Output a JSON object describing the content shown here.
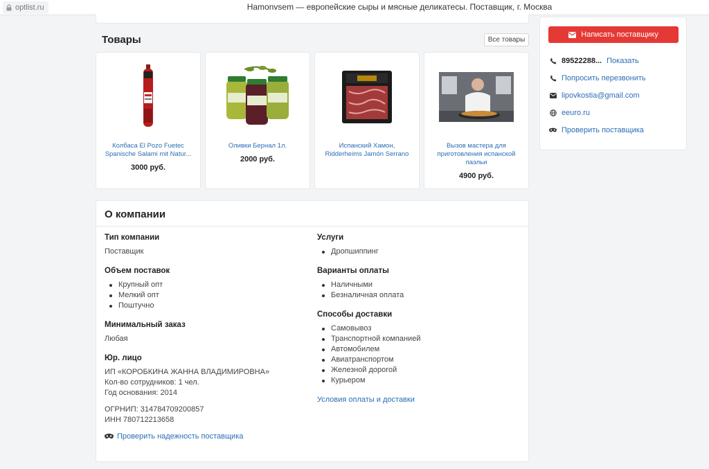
{
  "browser": {
    "url": "optlist.ru",
    "title": "Hamonvsem — европейские сыры и мясные деликатесы. Поставщик, г. Москва"
  },
  "products": {
    "header": "Товары",
    "all_label": "Все товары",
    "items": [
      {
        "name": "Колбаса El Pozo Fuetec Spanische Salami mit Natur...",
        "price": "3000 руб."
      },
      {
        "name": "Оливки Бернал 1л.",
        "price": "2000 руб."
      },
      {
        "name": "Испанский Хамон, Ridderheims Jamón Serrano",
        "price": ""
      },
      {
        "name": "Вызов мастера для приготовления испанской паэльи",
        "price": "4900 руб."
      }
    ]
  },
  "about": {
    "title": "О компании",
    "company_type": {
      "label": "Тип компании",
      "value": "Поставщик"
    },
    "volume": {
      "label": "Объем поставок",
      "items": [
        "Крупный опт",
        "Мелкий опт",
        "Поштучно"
      ]
    },
    "min_order": {
      "label": "Минимальный заказ",
      "value": "Любая"
    },
    "legal": {
      "label": "Юр. лицо",
      "name": "ИП «КОРОБКИНА ЖАННА ВЛАДИМИРОВНА»",
      "employees": "Кол-во сотрудников: 1 чел.",
      "founded": "Год основания: 2014",
      "ogrnip": "ОГРНИП: 314784709200857",
      "inn": "ИНН 780712213658"
    },
    "check_link": "Проверить надежность поставщика",
    "services": {
      "label": "Услуги",
      "items": [
        "Дропшиппинг"
      ]
    },
    "payment": {
      "label": "Варианты оплаты",
      "items": [
        "Наличными",
        "Безналичная оплата"
      ]
    },
    "delivery": {
      "label": "Способы доставки",
      "items": [
        "Самовывоз",
        "Транспортной компанией",
        "Автомобилем",
        "Авиатранспортом",
        "Железной дорогой",
        "Курьером"
      ]
    },
    "terms_link": "Условия оплаты и доставки"
  },
  "sidebar": {
    "write_label": "Написать поставщику",
    "phone": "89522288...",
    "show_label": "Показать",
    "callback": "Попросить перезвонить",
    "email": "lipovkostia@gmail.com",
    "website": "eeuro.ru",
    "check": "Проверить поставщика"
  },
  "colors": {
    "accent": "#e53935",
    "link": "#2a6db5"
  }
}
